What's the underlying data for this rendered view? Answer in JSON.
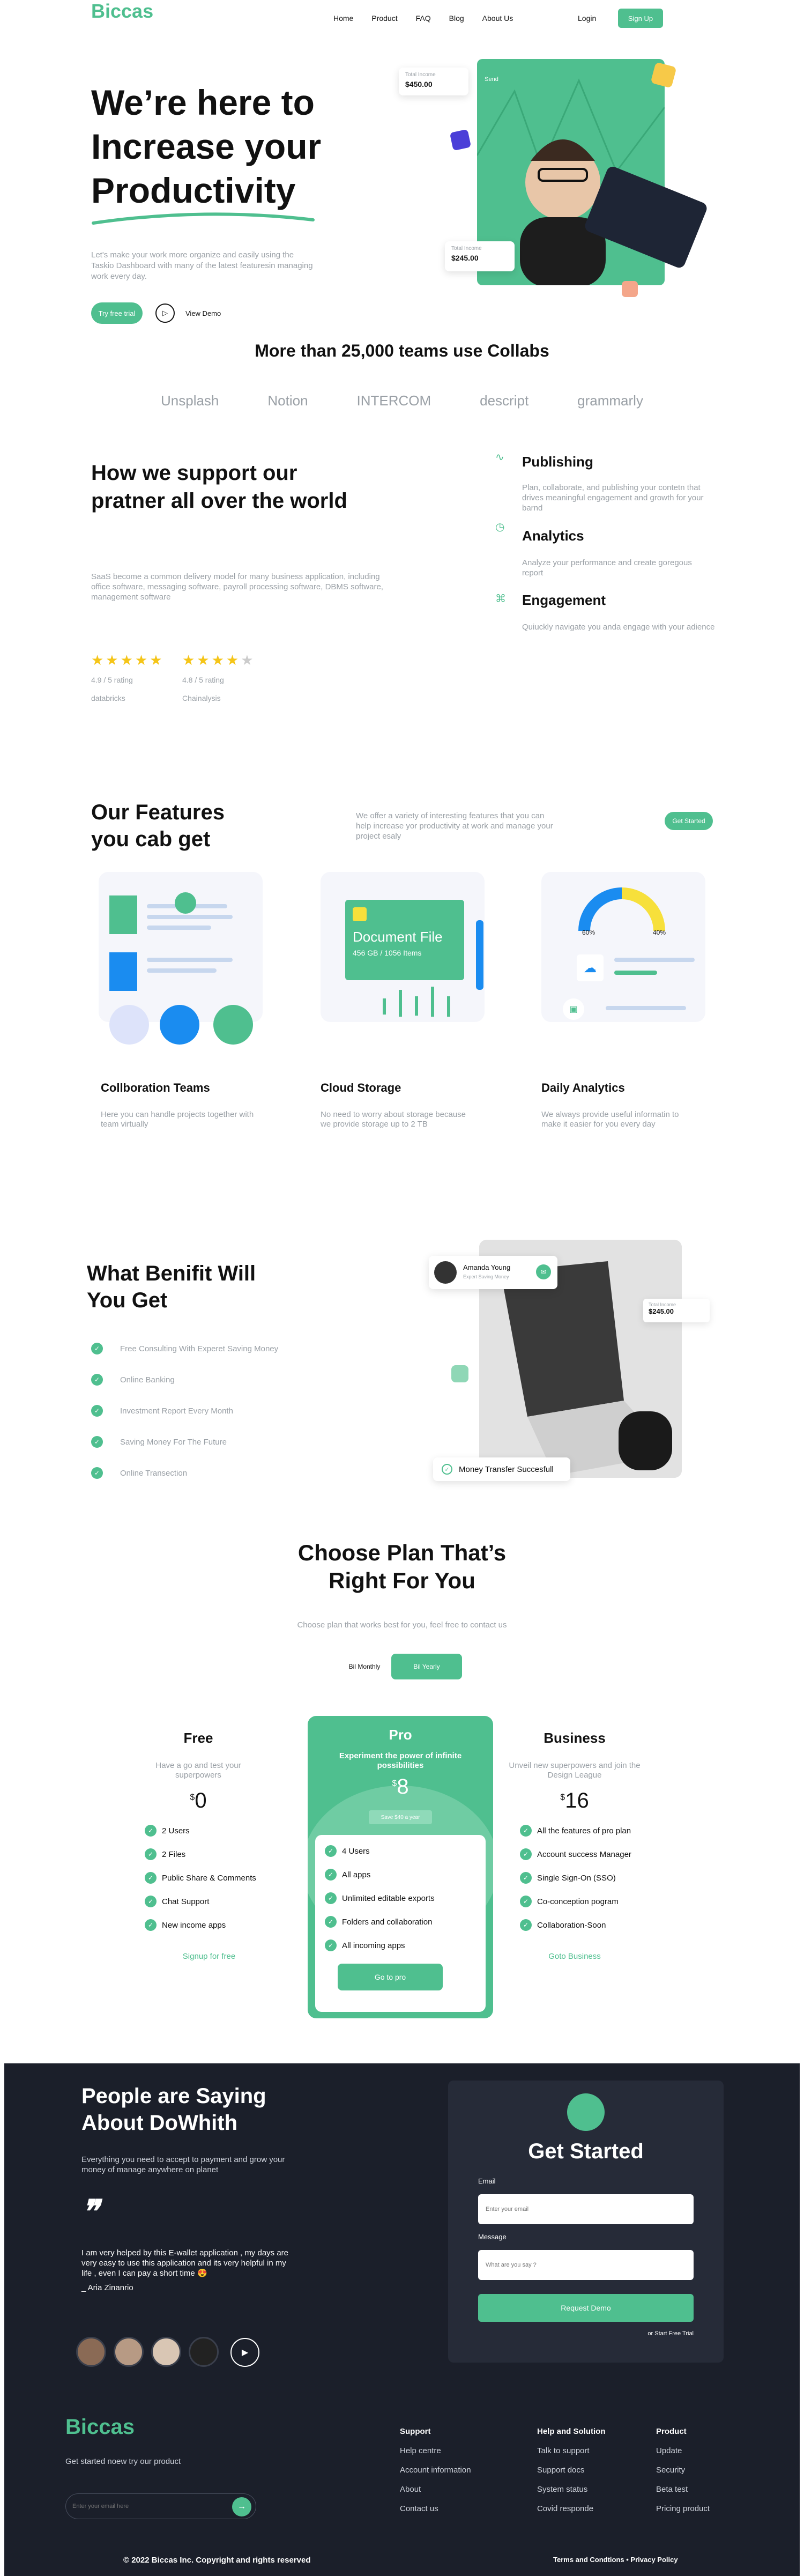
{
  "brand": "Biccas",
  "nav": {
    "items": [
      "Home",
      "Product",
      "FAQ",
      "Blog",
      "About Us"
    ],
    "login": "Login",
    "signup": "Sign Up"
  },
  "hero": {
    "title_1": "We’re here to",
    "title_2": "Increase your",
    "title_3": "Productivity",
    "desc": "Let's make your work more organize and easily using the Taskio Dashboard with many of the latest featuresin managing work every day.",
    "cta": "Try free trial",
    "demo": "View Demo",
    "card1_label": "Total Income",
    "card1_value": "$450.00",
    "card2_label": "Total Income",
    "card2_value": "$245.00",
    "badge": "Send"
  },
  "teams": {
    "title": "More than 25,000 teams use Collabs",
    "logos": [
      "Unsplash",
      "Notion",
      "INTERCOM",
      "descript",
      "grammarly"
    ]
  },
  "support": {
    "title": "How we support our pratner all over the world",
    "desc": "SaaS become a common delivery model for many business application, including office software, messaging software, payroll processing software, DBMS software, management software",
    "r1_rating": "4.9 / 5 rating",
    "r1_source": "databricks",
    "r2_rating": "4.8 / 5 rating",
    "r2_source": "Chainalysis",
    "items": [
      {
        "title": "Publishing",
        "desc": "Plan, collaborate, and publishing your contetn that drives meaningful engagement and growth for your barnd"
      },
      {
        "title": "Analytics",
        "desc": "Analyze your performance and create goregous report"
      },
      {
        "title": "Engagement",
        "desc": "Quiuckly navigate you anda engage with your adience"
      }
    ]
  },
  "features": {
    "title_1": "Our Features",
    "title_2": "you cab get",
    "desc": "We offer a variety of interesting features that you can help increase yor productivity at work and manage your project esaly",
    "cta": "Get Started",
    "doc_title": "Document File",
    "doc_sub": "456 GB / 1056 Items",
    "pct_left": "60%",
    "pct_right": "40%",
    "cards": [
      {
        "title": "Collboration Teams",
        "desc": "Here you can handle projects together with team virtually"
      },
      {
        "title": "Cloud Storage",
        "desc": "No need to worry about storage because we provide storage up to 2 TB"
      },
      {
        "title": "Daily Analytics",
        "desc": "We always provide useful informatin to make it easier for you every day"
      }
    ]
  },
  "benefit": {
    "title_1": "What Benifit Will",
    "title_2": "You Get",
    "items": [
      "Free Consulting With Experet Saving Money",
      "Online Banking",
      "Investment Report Every Month",
      "Saving Money For The Future",
      "Online Transection"
    ],
    "user_name": "Amanda Young",
    "user_sub": "Expert Saving Money",
    "income_label": "Total Income",
    "income_value": "$245.00",
    "transfer": "Money Transfer Succesfull"
  },
  "pricing": {
    "title_1": "Choose Plan That’s",
    "title_2": "Right For You",
    "sub": "Choose plan that works best for you, feel free to contact us",
    "toggle_monthly": "Bil Monthly",
    "toggle_yearly": "Bil Yearly",
    "free": {
      "name": "Free",
      "desc": "Have a go and test your superpowers",
      "price": "0",
      "items": [
        "2 Users",
        "2 Files",
        "Public Share & Comments",
        "Chat Support",
        "New income apps"
      ],
      "cta": "Signup for free"
    },
    "pro": {
      "name": "Pro",
      "desc": "Experiment the power of infinite possibilities",
      "price": "8",
      "save": "Save $40 a year",
      "items": [
        "4 Users",
        "All apps",
        "Unlimited editable exports",
        "Folders and collaboration",
        "All incoming apps"
      ],
      "cta": "Go to pro"
    },
    "business": {
      "name": "Business",
      "desc": "Unveil new superpowers and join the Design League",
      "price": "16",
      "items": [
        "All the features of pro plan",
        "Account success Manager",
        "Single Sign-On (SSO)",
        "Co-conception pogram",
        "Collaboration-Soon"
      ],
      "cta": "Goto Business"
    },
    "currency": "$"
  },
  "testimonial": {
    "title_1": "People are Saying",
    "title_2": "About DoWhith",
    "sub": "Everything you need to accept to payment and grow your money of manage anywhere on planet",
    "quote": "I am very helped by this E-wallet application , my days are very easy to use this application and its very helpful in my life , even I can pay a short time 😍",
    "author": "_ Aria Zinanrio"
  },
  "started": {
    "title": "Get Started",
    "email_label": "Email",
    "email_ph": "Enter your email",
    "msg_label": "Message",
    "msg_ph": "What are you say ?",
    "cta": "Request Demo",
    "trial": "or Start Free Trial"
  },
  "footer": {
    "tagline": "Get started noew try our product",
    "email_ph": "Enter your email here",
    "cols": [
      {
        "title": "Support",
        "links": [
          "Help centre",
          "Account information",
          "About",
          "Contact us"
        ]
      },
      {
        "title": "Help and Solution",
        "links": [
          "Talk to support",
          "Support docs",
          "System status",
          "Covid responde"
        ]
      },
      {
        "title": "Product",
        "links": [
          "Update",
          "Security",
          "Beta test",
          "Pricing product"
        ]
      }
    ],
    "copyright": "© 2022 Biccas Inc. Copyright and rights reserved",
    "legal": "Terms and Condtions • Privacy Policy"
  },
  "colors": {
    "accent": "#4fbf8f",
    "dark": "#1b1f2a"
  }
}
